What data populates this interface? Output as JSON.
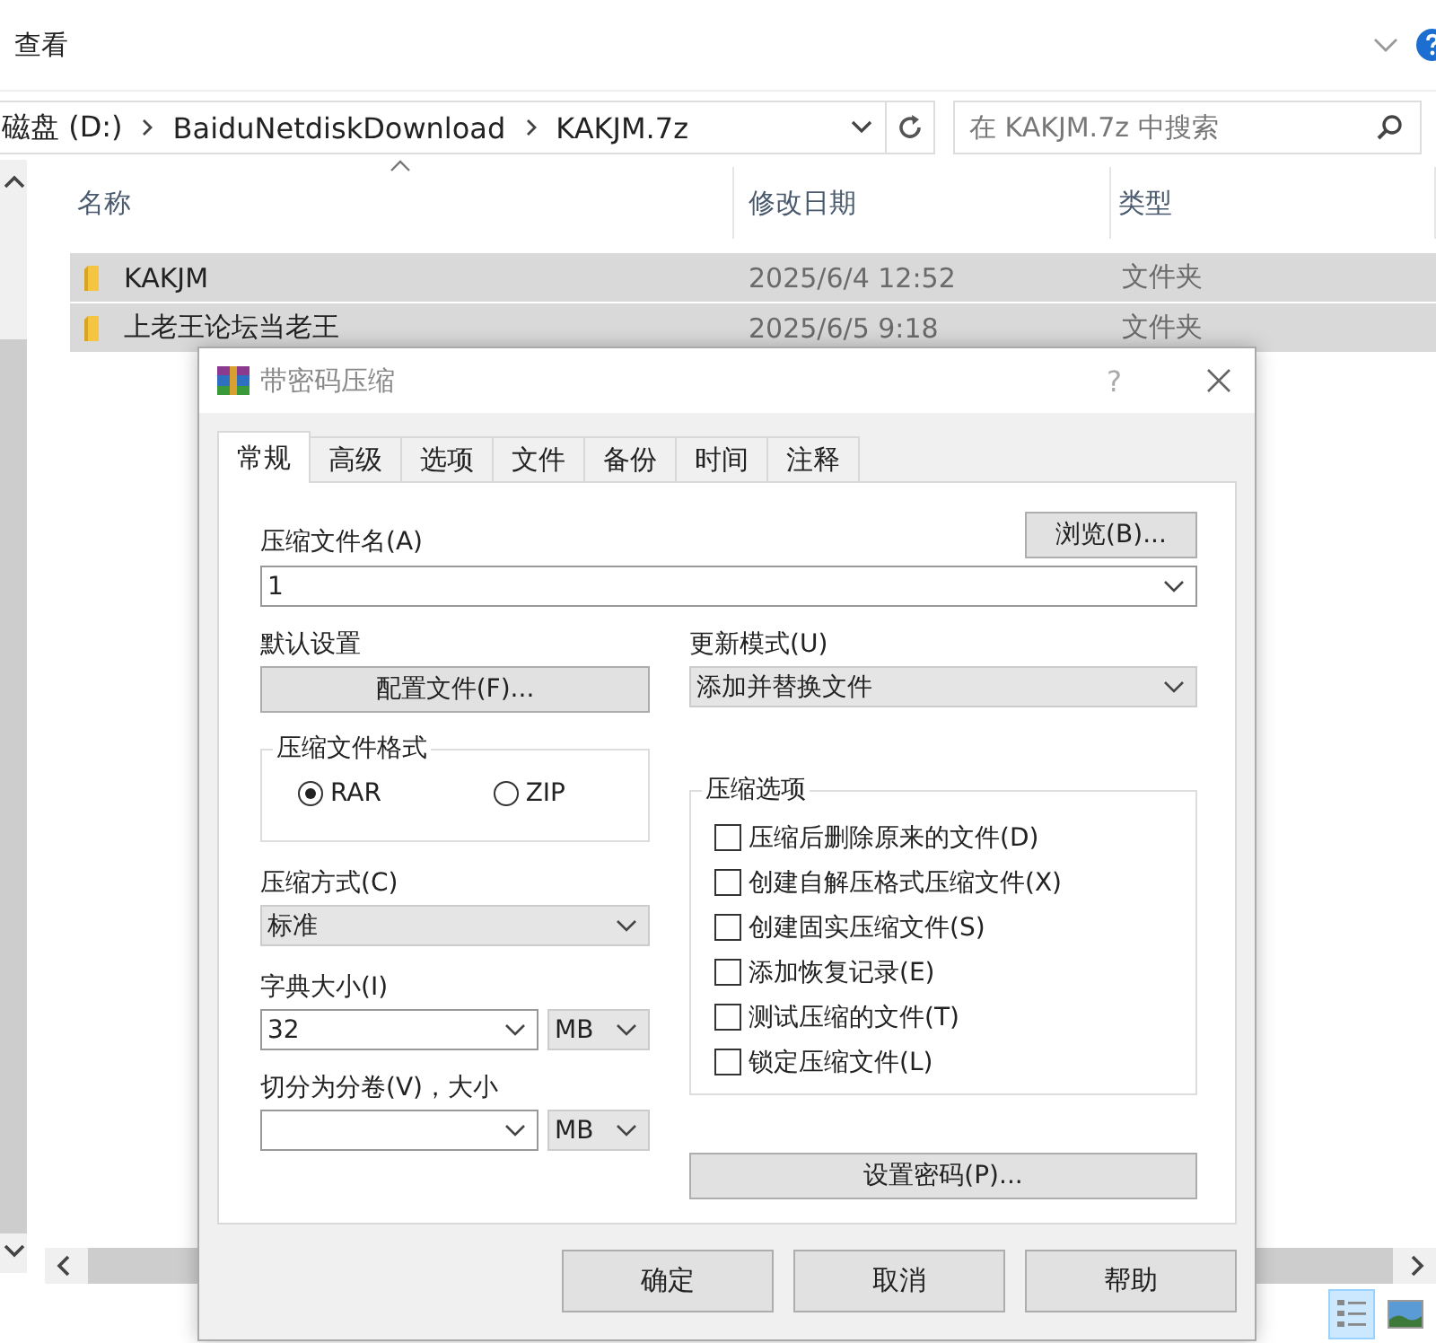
{
  "explorer": {
    "toolbar_label": "查看",
    "address": [
      "磁盘 (D:)",
      "BaiduNetdiskDownload",
      "KAKJM.7z"
    ],
    "search": {
      "placeholder": "在 KAKJM.7z 中搜索"
    },
    "columns": [
      "名称",
      "修改日期",
      "类型"
    ],
    "rows": [
      {
        "name": "KAKJM",
        "date": "2025/6/4 12:52",
        "type": "文件夹",
        "selected": true
      },
      {
        "name": "上老王论坛当老王",
        "date": "2025/6/5 9:18",
        "type": "文件夹",
        "selected": true
      }
    ]
  },
  "dialog": {
    "title": "带密码压缩",
    "help": "?",
    "tabs": [
      {
        "label": "常规",
        "selected": true
      },
      {
        "label": "高级",
        "selected": false
      },
      {
        "label": "选项",
        "selected": false
      },
      {
        "label": "文件",
        "selected": false
      },
      {
        "label": "备份",
        "selected": false
      },
      {
        "label": "时间",
        "selected": false
      },
      {
        "label": "注释",
        "selected": false
      }
    ],
    "archive_name": {
      "label": "压缩文件名(A)",
      "value": "1",
      "browse": "浏览(B)..."
    },
    "default_settings": {
      "label": "默认设置",
      "button": "配置文件(F)..."
    },
    "update_mode": {
      "label": "更新模式(U)",
      "value": "添加并替换文件"
    },
    "format": {
      "title": "压缩文件格式",
      "options": [
        {
          "label": "RAR",
          "selected": true
        },
        {
          "label": "ZIP",
          "selected": false
        }
      ]
    },
    "method": {
      "label": "压缩方式(C)",
      "value": "标准"
    },
    "dictionary": {
      "label": "字典大小(I)",
      "value": "32",
      "unit": "MB"
    },
    "split": {
      "label": "切分为分卷(V)，大小",
      "unit": "MB"
    },
    "options": {
      "title": "压缩选项",
      "items": [
        {
          "label": "压缩后删除原来的文件(D)",
          "checked": false
        },
        {
          "label": "创建自解压格式压缩文件(X)",
          "checked": false
        },
        {
          "label": "创建固实压缩文件(S)",
          "checked": false
        },
        {
          "label": "添加恢复记录(E)",
          "checked": false
        },
        {
          "label": "测试压缩的文件(T)",
          "checked": false
        },
        {
          "label": "锁定压缩文件(L)",
          "checked": false
        }
      ]
    },
    "password_button": "设置密码(P)...",
    "buttons": [
      "确定",
      "取消",
      "帮助"
    ]
  }
}
